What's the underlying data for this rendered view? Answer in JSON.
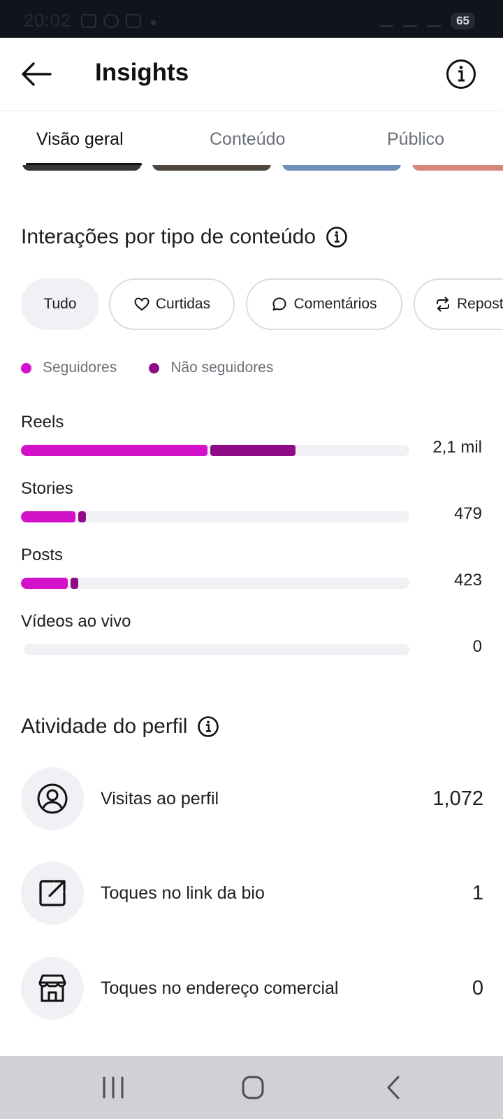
{
  "status_bar": {
    "time": "20:02",
    "battery": "65",
    "left_icons": [
      "screenshot-icon",
      "whatsapp-icon",
      "instagram-icon"
    ],
    "right_icons": [
      "mute-icon",
      "wifi-icon",
      "signal-icon"
    ]
  },
  "header": {
    "title": "Insights",
    "back_icon": "arrow-left-icon",
    "info_icon": "info-icon"
  },
  "tabs": [
    {
      "label": "Visão geral",
      "active": true
    },
    {
      "label": "Conteúdo",
      "active": false
    },
    {
      "label": "Público",
      "active": false
    }
  ],
  "interactions": {
    "title": "Interações por tipo de conteúdo",
    "chips": [
      {
        "label": "Tudo",
        "icon": "",
        "selected": true
      },
      {
        "label": "Curtidas",
        "icon": "heart-icon",
        "selected": false
      },
      {
        "label": "Comentários",
        "icon": "comment-icon",
        "selected": false
      },
      {
        "label": "Repost",
        "icon": "repost-icon",
        "selected": false
      }
    ],
    "legend": [
      {
        "label": "Seguidores",
        "color": "#d211c9"
      },
      {
        "label": "Não seguidores",
        "color": "#8e0a87"
      }
    ],
    "rows": [
      {
        "label": "Reels",
        "value": "2,1 mil",
        "followers_fraction": 0.48,
        "non_followers_fraction": 0.22
      },
      {
        "label": "Stories",
        "value": "479",
        "followers_fraction": 0.14,
        "non_followers_fraction": 0.02
      },
      {
        "label": "Posts",
        "value": "423",
        "followers_fraction": 0.12,
        "non_followers_fraction": 0.02
      },
      {
        "label": "Vídeos ao vivo",
        "value": "0",
        "followers_fraction": 0,
        "non_followers_fraction": 0
      }
    ]
  },
  "activity": {
    "title": "Atividade do perfil",
    "items": [
      {
        "label": "Visitas ao perfil",
        "value": "1,072",
        "icon": "profile-icon"
      },
      {
        "label": "Toques no link da bio",
        "value": "1",
        "icon": "external-link-icon"
      },
      {
        "label": "Toques no endereço comercial",
        "value": "0",
        "icon": "storefront-icon"
      }
    ]
  },
  "nav_bar": {
    "buttons": [
      "recent-apps-icon",
      "home-icon",
      "back-icon"
    ]
  }
}
